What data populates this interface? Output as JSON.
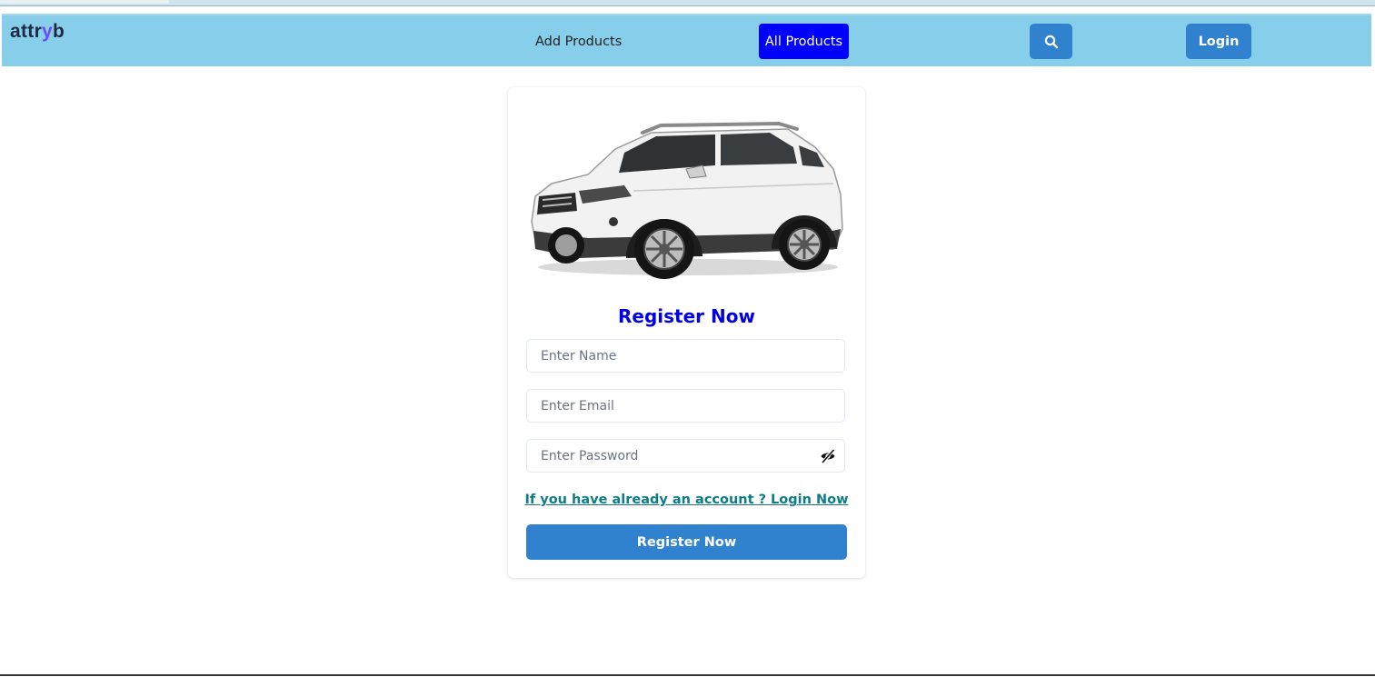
{
  "navbar": {
    "brand_prefix": "attr",
    "brand_accent": "y",
    "brand_suffix": "b",
    "add_products": "Add Products",
    "all_products": "All Products",
    "search_icon": "search-icon",
    "login": "Login"
  },
  "register": {
    "image": "suv-car-image",
    "title": "Register Now",
    "name_placeholder": "Enter Name",
    "email_placeholder": "Enter Email",
    "password_placeholder": "Enter Password",
    "password_toggle_icon": "eye-slash-icon",
    "login_link": "If you have already an account ? Login Now",
    "submit": "Register Now"
  },
  "colors": {
    "navbar_bg": "#87ceeb",
    "all_products_bg": "#0000ff",
    "button_bg": "#3182ce",
    "title_color": "#0000e6",
    "link_color": "#0e7c86"
  }
}
